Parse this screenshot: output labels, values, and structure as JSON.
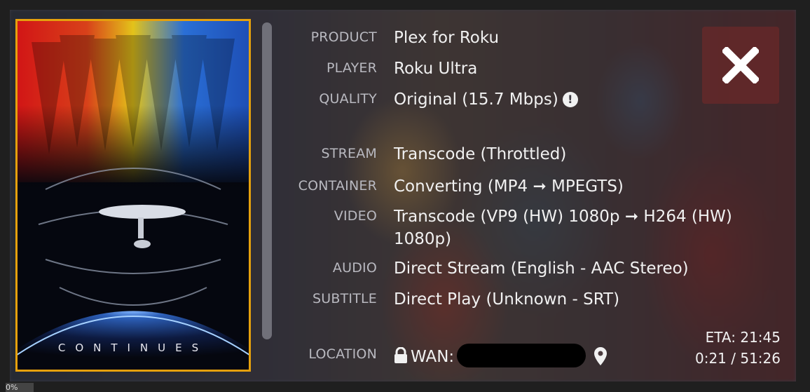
{
  "poster": {
    "caption": "CONTINUES"
  },
  "details": [
    {
      "label": "PRODUCT",
      "value": "Plex for Roku"
    },
    {
      "label": "PLAYER",
      "value": "Roku Ultra"
    },
    {
      "label": "QUALITY",
      "value": "Original (15.7 Mbps)"
    },
    {
      "label": "STREAM",
      "value": "Transcode (Throttled)"
    },
    {
      "label": "CONTAINER",
      "value": "Converting (MP4 ➞ MPEGTS)"
    },
    {
      "label": "VIDEO",
      "value": "Transcode (VP9 (HW) 1080p ➞ H264 (HW) 1080p)"
    },
    {
      "label": "AUDIO",
      "value": "Direct Stream (English - AAC Stereo)"
    },
    {
      "label": "SUBTITLE",
      "value": "Direct Play (Unknown - SRT)"
    },
    {
      "label": "LOCATION",
      "value": "WAN:"
    }
  ],
  "eta": {
    "eta_text": "ETA: 21:45",
    "progress_text": "0:21 / 51:26"
  },
  "footer": {
    "percent": "0%"
  },
  "colors": {
    "accent": "#e5a00d"
  },
  "icons": {
    "close": "close-icon",
    "lock": "lock-icon",
    "location": "map-pin-icon",
    "warning": "exclamation-circle-icon"
  }
}
